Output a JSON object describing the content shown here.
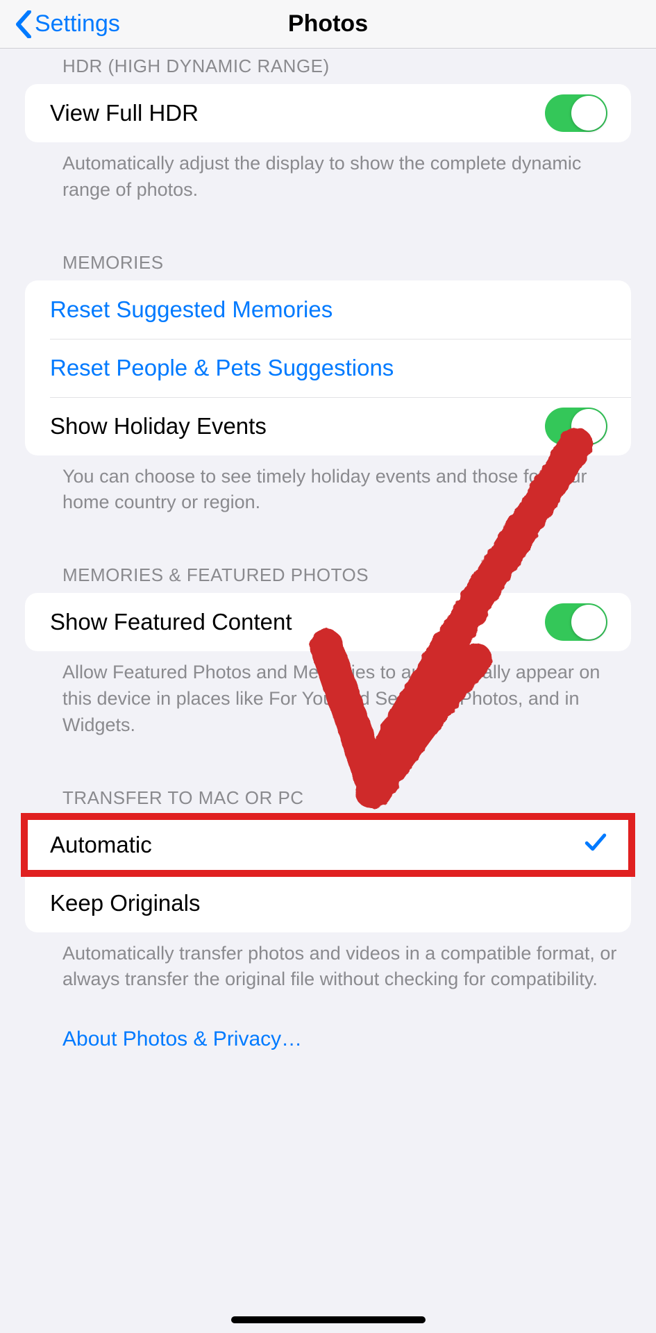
{
  "nav": {
    "back_label": "Settings",
    "title": "Photos"
  },
  "hdr": {
    "header": "HDR (HIGH DYNAMIC RANGE)",
    "row_label": "View Full HDR",
    "toggle_on": true,
    "footer": "Automatically adjust the display to show the complete dynamic range of photos."
  },
  "memories": {
    "header": "MEMORIES",
    "reset_suggested": "Reset Suggested Memories",
    "reset_people": "Reset People & Pets Suggestions",
    "holiday_label": "Show Holiday Events",
    "holiday_on": true,
    "footer": "You can choose to see timely holiday events and those for your home country or region."
  },
  "featured": {
    "header": "MEMORIES & FEATURED PHOTOS",
    "row_label": "Show Featured Content",
    "toggle_on": true,
    "footer": "Allow Featured Photos and Memories to automatically appear on this device in places like For You and Search in Photos, and in Widgets."
  },
  "transfer": {
    "header": "TRANSFER TO MAC OR PC",
    "option_auto": "Automatic",
    "option_keep": "Keep Originals",
    "selected": "auto",
    "footer": "Automatically transfer photos and videos in a compatible format, or always transfer the original file without checking for compatibility."
  },
  "about_link": "About Photos & Privacy…",
  "annotation": {
    "color": "#cf2a2a"
  }
}
